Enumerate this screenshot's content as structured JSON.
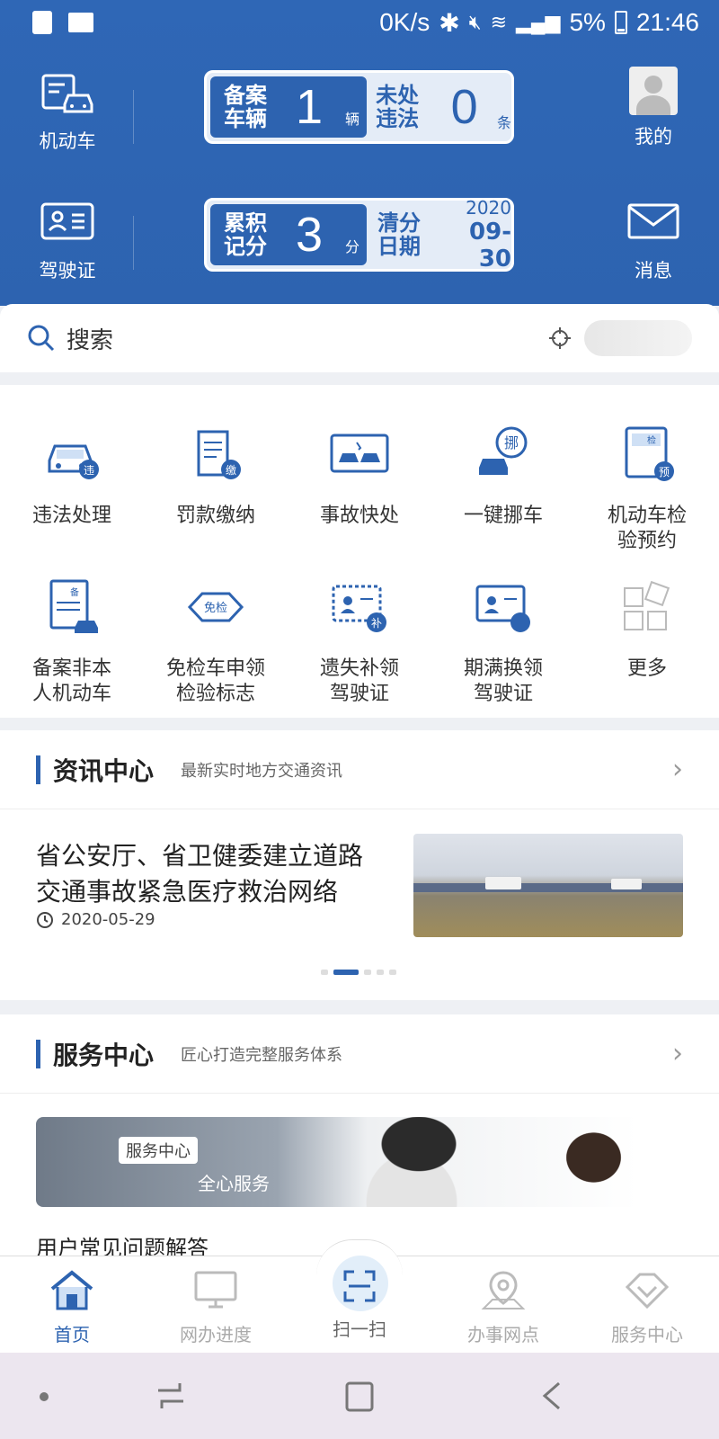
{
  "status_bar": {
    "speed": "0K/s",
    "battery": "5%",
    "time": "21:46"
  },
  "header": {
    "vehicle_label": "机动车",
    "license_label": "驾驶证",
    "mine_label": "我的",
    "message_label": "消息",
    "card1": {
      "label_a": "备案车辆",
      "label_a1": "备案",
      "label_a2": "车辆",
      "value_a": "1",
      "unit_a": "辆",
      "label_b1": "未处",
      "label_b2": "违法",
      "value_b": "0",
      "unit_b": "条"
    },
    "card2": {
      "label_a1": "累积",
      "label_a2": "记分",
      "value_a": "3",
      "unit_a": "分",
      "label_b1": "清分",
      "label_b2": "日期",
      "year": "2020",
      "date": "09-30"
    }
  },
  "search": {
    "placeholder": "搜索"
  },
  "services": [
    {
      "line1": "违法处理",
      "line2": "",
      "icon": "car-violation-icon"
    },
    {
      "line1": "罚款缴纳",
      "line2": "",
      "icon": "fine-payment-icon"
    },
    {
      "line1": "事故快处",
      "line2": "",
      "icon": "accident-icon"
    },
    {
      "line1": "一键挪车",
      "line2": "",
      "icon": "move-car-icon"
    },
    {
      "line1": "机动车检",
      "line2": "验预约",
      "icon": "inspection-booking-icon"
    },
    {
      "line1": "备案非本",
      "line2": "人机动车",
      "icon": "register-car-icon"
    },
    {
      "line1": "免检车申领",
      "line2": "检验标志",
      "icon": "exempt-badge-icon"
    },
    {
      "line1": "遗失补领",
      "line2": "驾驶证",
      "icon": "reissue-license-icon"
    },
    {
      "line1": "期满换领",
      "line2": "驾驶证",
      "icon": "renew-license-icon"
    },
    {
      "line1": "更多",
      "line2": "",
      "icon": "more-icon"
    }
  ],
  "news": {
    "title": "资讯中心",
    "subtitle": "最新实时地方交通资讯",
    "headline1": "省公安厅、省卫健委建立道路",
    "headline2": "交通事故紧急医疗救治网络",
    "date": "2020-05-29"
  },
  "service_center": {
    "title": "服务中心",
    "subtitle": "匠心打造完整服务体系",
    "banner_tag": "服务中心",
    "banner_text": "全心服务",
    "faq": "用户常见问题解答"
  },
  "tabs": [
    {
      "label": "首页",
      "icon": "home-icon"
    },
    {
      "label": "网办进度",
      "icon": "monitor-icon"
    },
    {
      "label": "扫一扫",
      "icon": "scan-icon"
    },
    {
      "label": "办事网点",
      "icon": "location-icon"
    },
    {
      "label": "服务中心",
      "icon": "service-icon"
    }
  ],
  "colors": {
    "primary": "#2d63b0",
    "header_bg": "#2f67b6"
  }
}
